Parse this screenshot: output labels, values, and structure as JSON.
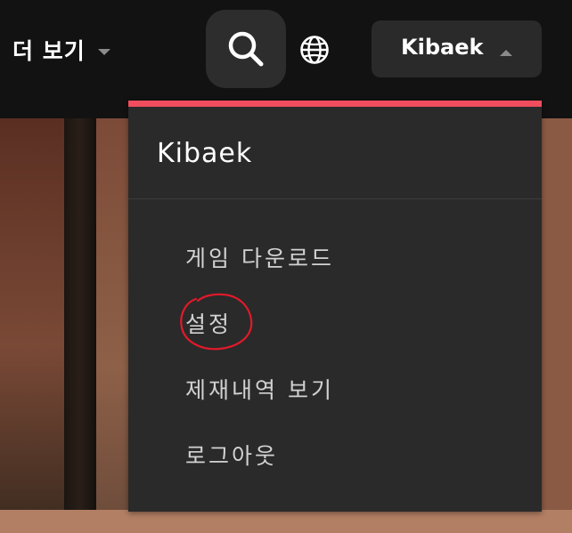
{
  "nav": {
    "more_label": "더 보기",
    "more_caret_icon": "caret-down-icon",
    "search_icon": "search-icon",
    "globe_icon": "globe-icon",
    "account_name": "Kibaek",
    "account_caret_icon": "caret-up-icon"
  },
  "dropdown": {
    "accent_color": "#f04e5e",
    "username": "Kibaek",
    "items": [
      {
        "label": "게임 다운로드"
      },
      {
        "label": "설정"
      },
      {
        "label": "제재내역 보기"
      },
      {
        "label": "로그아웃"
      }
    ],
    "annotation_color": "#e01a2a"
  }
}
